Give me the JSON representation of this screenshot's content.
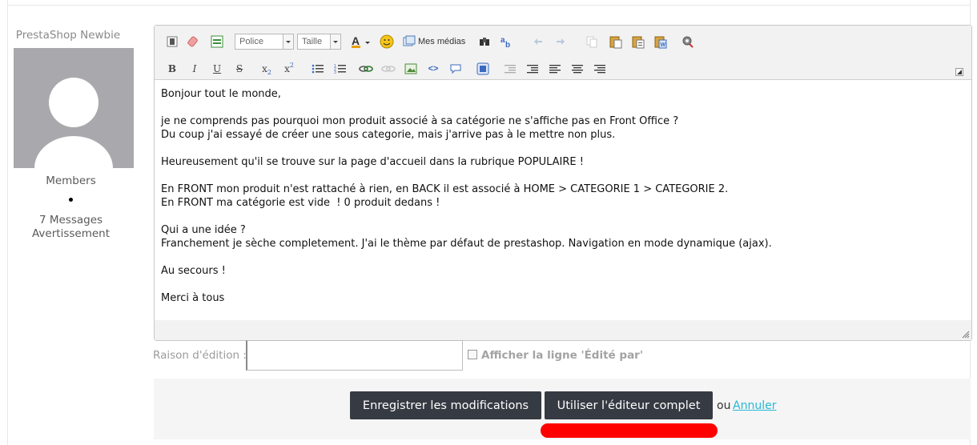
{
  "user": {
    "username": "PrestaShop Newbie",
    "group": "Members",
    "messages": "7 Messages",
    "warning": "Avertissement"
  },
  "toolbar": {
    "font_combo": "Police",
    "size_combo": "Taille",
    "media_label": "Mes médias",
    "row1_icons": [
      "source-icon",
      "eraser-icon",
      "template-icon",
      "font-color-icon",
      "emoticon-icon",
      "media-icon",
      "find-icon",
      "spellcheck-icon",
      "undo-icon",
      "redo-icon",
      "copy-icon",
      "paste-icon",
      "paste-text-icon",
      "paste-word-icon",
      "settings-icon"
    ],
    "row2_icons": [
      "bold-icon",
      "italic-icon",
      "underline-icon",
      "strikethrough-icon",
      "subscript-icon",
      "superscript-icon",
      "bullet-list-icon",
      "numbered-list-icon",
      "link-icon",
      "unlink-icon",
      "image-icon",
      "code-icon",
      "quote-icon",
      "spoiler-icon",
      "indent-icon",
      "outdent-icon",
      "align-left-icon",
      "align-center-icon",
      "align-right-icon"
    ]
  },
  "editor": {
    "lines": [
      "Bonjour tout le monde,",
      "je ne comprends pas pourquoi mon produit associé à sa catégorie ne s'affiche pas en Front Office ?",
      "Du coup j'ai essayé de créer une sous categorie, mais j'arrive pas à le mettre non plus.",
      "Heureusement qu'il se trouve sur la page d'accueil dans la rubrique POPULAIRE !",
      "En FRONT mon produit n'est rattaché à rien, en BACK il est associé à HOME > CATEGORIE 1 > CATEGORIE 2.",
      "En FRONT ma catégorie est vide  ! 0 produit dedans !",
      "Qui a une idée ?",
      "Franchement je sèche completement. J'ai le thème par défaut de prestashop. Navigation en mode dynamique (ajax).",
      "Au secours !",
      "Merci à tous"
    ]
  },
  "edit_reason": {
    "label": "Raison d'édition :",
    "value": "",
    "show_edited_label": "Afficher la ligne 'Édité par'"
  },
  "actions": {
    "save_label": "Enregistrer les modifications",
    "full_editor_label": "Utiliser l'éditeur complet",
    "or_text": "ou",
    "cancel_label": "Annuler"
  },
  "colors": {
    "button_bg": "#363a42",
    "link": "#25b9d7",
    "highlight": "#ff0000"
  }
}
